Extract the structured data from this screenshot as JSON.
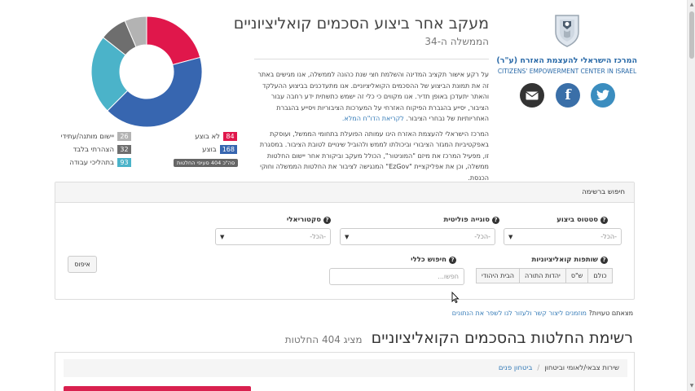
{
  "org": {
    "name_he": "המרכז הישראלי להעצמת האזרח (ע\"ר)",
    "name_en": "CITIZENS' EMPOWERMENT CENTER IN ISRAEL"
  },
  "social": {
    "twitter_icon": "twitter-icon",
    "facebook_icon": "facebook-icon",
    "facebook_glyph": "f",
    "mail_icon": "mail-icon"
  },
  "header": {
    "title": "מעקב אחר ביצוע הסכמים קואליציוניים",
    "subtitle": "הממשלה ה-34"
  },
  "intro": {
    "p1": "על רקע אישור תקציב המדינה והשלמת חצי שנת כהונה לממשלה, אנו מגישים באתר זה את תמונת הביצוע של ההסכמים הקואליציוניים. אנו מתעדכנים בביצוע ההעלקד והאתר יתעדכן באופן תדיר. אנו מקווים כי כלי זה ישמש כתשתית ידע רחבה עבור הציבור, יסייע בהגברת הפיקוח האזרחי על המערכות הציבוריות ויסייע בהגברת האחריותיות של נבחרי הציבור.",
    "p1_link": "לקריאת הדו\"ח המלא.",
    "p2": "המרכז הישראלי להעצמת האזרח הינו עמותה הפועלת בתחומי הממשל, ועוסקת באפקטיביות המגזר הציבורי וביכולתו לממש ולהוביל שינויים לטובת הציבור. במסגרת זו, מפעיל המרכז את מיזם \"המוניטור\", הכולל מעקב וביקורת אחר יישום החלטות ממשלה, וכן את אפליקציית \"EzGov\" המנגישה לציבור את החלטות הממשלה וחוקי הכנסת."
  },
  "chart_data": {
    "type": "pie",
    "donut": true,
    "total_label": "סה\"כ 404 סעיפי החלטות",
    "total": 404,
    "slices": [
      {
        "label": "לא בוצע",
        "value": 84,
        "color": "#e0174b"
      },
      {
        "label": "בוצע",
        "value": 168,
        "color": "#3766b0"
      },
      {
        "label": "בתהליכי עבודה",
        "value": 93,
        "color": "#4bb3c9"
      },
      {
        "label": "הצהרתי בלבד",
        "value": 32,
        "color": "#6e6e6e"
      },
      {
        "label": "יישום מותנה/עתידי",
        "value": 26,
        "color": "#b3b3b3"
      }
    ]
  },
  "filters": {
    "panel_title": "חיפוש ברשימה",
    "status_label": "סטטוס ביצוע",
    "status_value": "-הכל-",
    "policy_label": "סוגייה פוליטית",
    "policy_value": "-הכל-",
    "sector_label": "סקטוריאלי",
    "sector_value": "-הכל-",
    "partners_label": "שותפות קואליציוניות",
    "partners": [
      "כולם",
      "ש\"ס",
      "יהדות התורה",
      "הבית היהודי"
    ],
    "search_label": "חיפוש כללי",
    "search_placeholder": "חפשו...",
    "reset_label": "איפוס",
    "help_glyph": "?"
  },
  "error_note": {
    "text": "מצאתם טעויות?",
    "link": "מוזמנים ליצור קשר ולעזור לנו לשפר את הנתונים"
  },
  "list": {
    "title": "רשימת החלטות בהסכמים הקואליציוניים",
    "count": "מציג 404 החלטות",
    "crumb_first": "שירות צבאי/לאומי וביטחון",
    "crumb_sep": "/",
    "crumb_second": "ביטחון פנים",
    "first_item_title": "..."
  }
}
